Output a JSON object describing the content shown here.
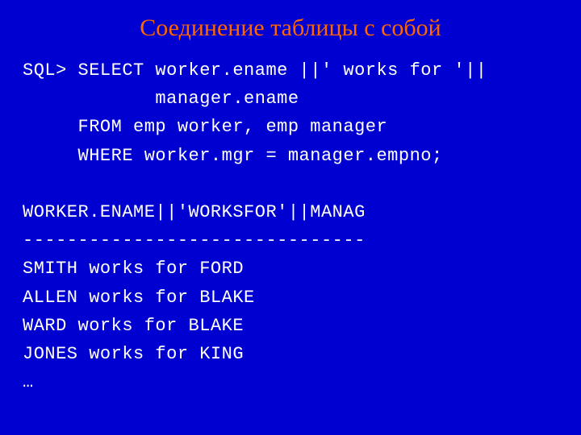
{
  "title": "Соединение таблицы с собой",
  "code": {
    "l1": "SQL> SELECT worker.ename ||' works for '||",
    "l2": "            manager.ename",
    "l3": "     FROM emp worker, emp manager",
    "l4": "     WHERE worker.mgr = manager.empno;",
    "l5": "",
    "l6": "WORKER.ENAME||'WORKSFOR'||MANAG",
    "l7": "-------------------------------",
    "l8": "SMITH works for FORD",
    "l9": "ALLEN works for BLAKE",
    "l10": "WARD works for BLAKE",
    "l11": "JONES works for KING",
    "l12": "…"
  }
}
